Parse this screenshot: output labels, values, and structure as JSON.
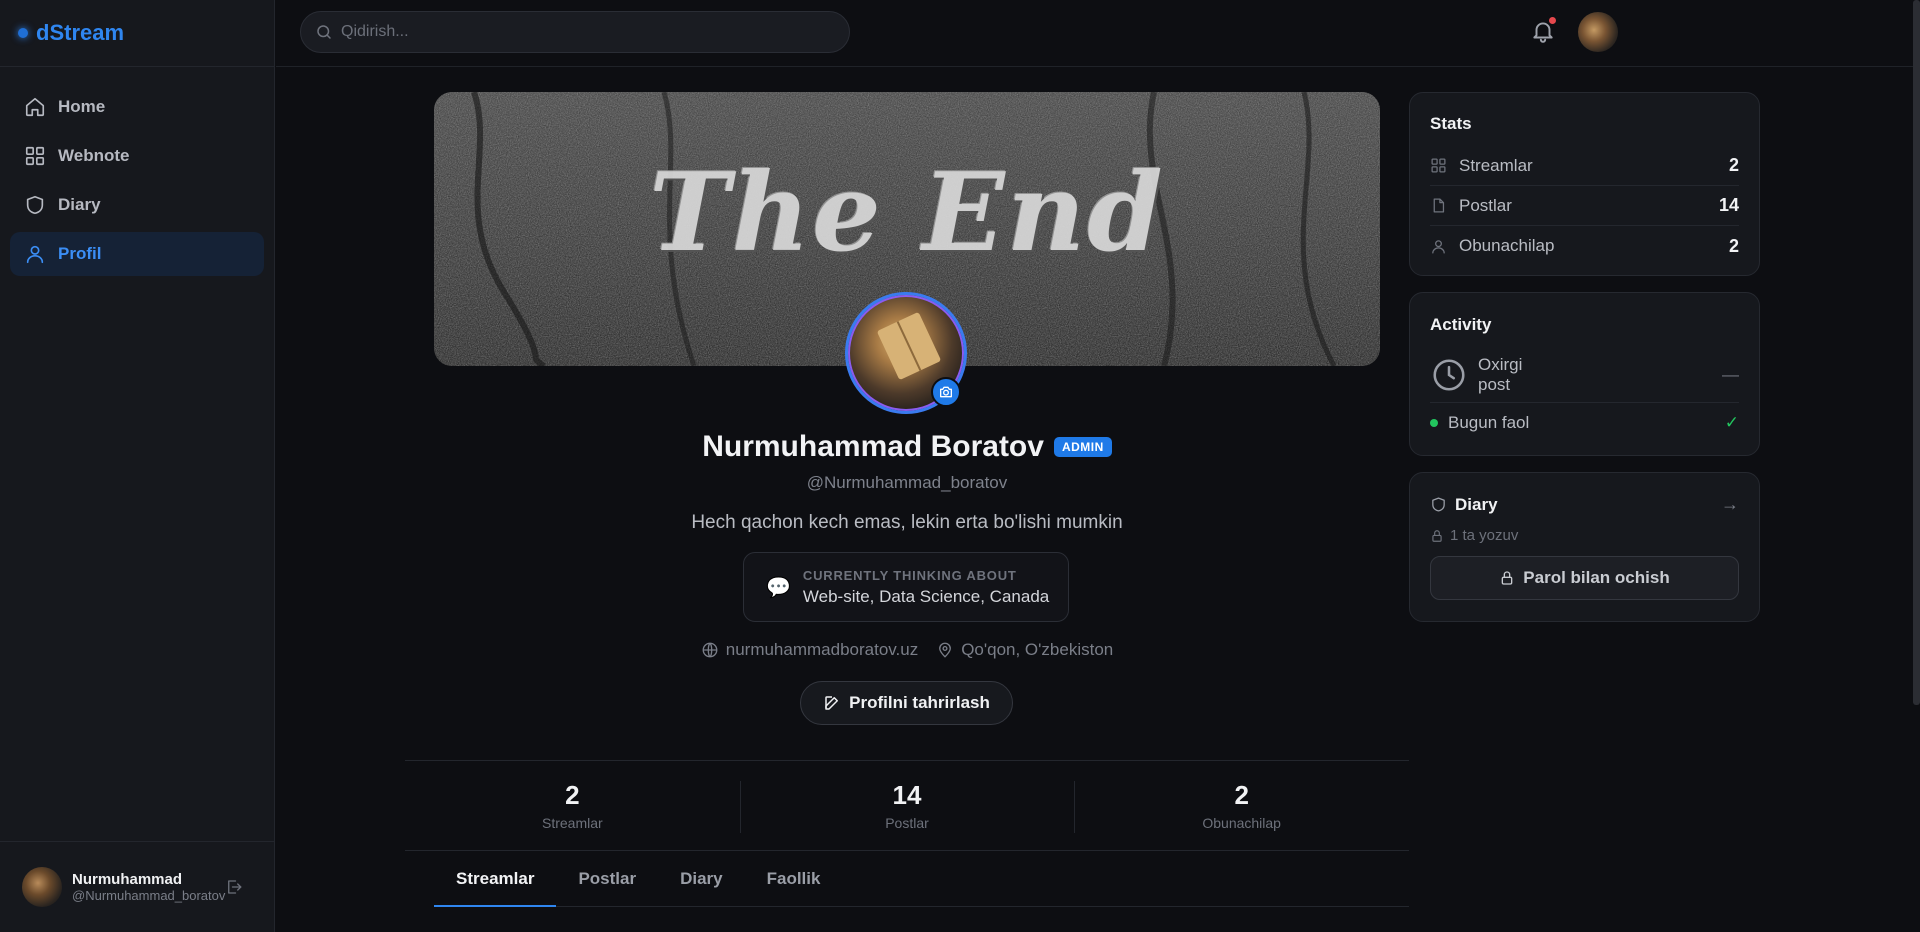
{
  "brand": {
    "name": "dStream"
  },
  "search": {
    "placeholder": "Qidirish..."
  },
  "sidebar": {
    "items": [
      {
        "label": "Home"
      },
      {
        "label": "Webnote"
      },
      {
        "label": "Diary"
      },
      {
        "label": "Profil"
      }
    ],
    "user": {
      "name": "Nurmuhammad",
      "handle": "@Nurmuhammad_boratov"
    }
  },
  "profile": {
    "cover_text": "The End",
    "name": "Nurmuhammad Boratov",
    "badge": "ADMIN",
    "handle": "@Nurmuhammad_boratov",
    "bio": "Hech qachon kech emas, lekin erta bo'lishi mumkin",
    "thinking_label": "CURRENTLY THINKING ABOUT",
    "thinking_value": "Web-site, Data Science, Canada",
    "website": "nurmuhammadboratov.uz",
    "location": "Qo'qon, O'zbekiston",
    "edit_label": "Profilni tahrirlash"
  },
  "stats_row": [
    {
      "value": "2",
      "label": "Streamlar"
    },
    {
      "value": "14",
      "label": "Postlar"
    },
    {
      "value": "2",
      "label": "Obunachilap"
    }
  ],
  "tabs": [
    {
      "label": "Streamlar"
    },
    {
      "label": "Postlar"
    },
    {
      "label": "Diary"
    },
    {
      "label": "Faollik"
    }
  ],
  "stats_panel": {
    "title": "Stats",
    "rows": [
      {
        "label": "Streamlar",
        "value": "2"
      },
      {
        "label": "Postlar",
        "value": "14"
      },
      {
        "label": "Obunachilap",
        "value": "2"
      }
    ]
  },
  "activity_panel": {
    "title": "Activity",
    "last_post_label": "Oxirgi post",
    "last_post_value": "—",
    "today_label": "Bugun faol",
    "today_mark": "✓"
  },
  "diary_panel": {
    "title": "Diary",
    "arrow": "→",
    "count": "1 ta yozuv",
    "button_label": "Parol bilan ochish"
  },
  "colors": {
    "accent": "#2f86f0",
    "background": "#0d0e12",
    "panel": "#16181d",
    "online": "#22c55e",
    "notification": "#e5484d"
  }
}
